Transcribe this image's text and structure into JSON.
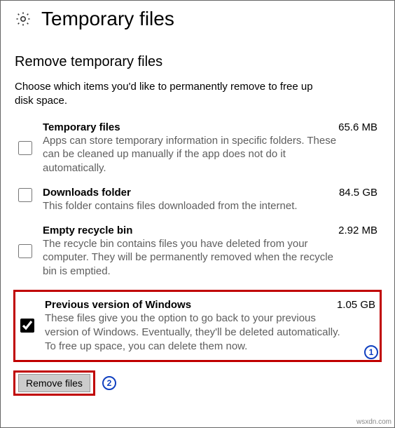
{
  "header": {
    "title": "Temporary files"
  },
  "section": {
    "heading": "Remove temporary files",
    "description": "Choose which items you'd like to permanently remove to free up disk space."
  },
  "items": [
    {
      "title": "Temporary files",
      "size": "65.6 MB",
      "description": "Apps can store temporary information in specific folders. These can be cleaned up manually if the app does not do it automatically.",
      "checked": false
    },
    {
      "title": "Downloads folder",
      "size": "84.5 GB",
      "description": "This folder contains files downloaded from the internet.",
      "checked": false
    },
    {
      "title": "Empty recycle bin",
      "size": "2.92 MB",
      "description": "The recycle bin contains files you have deleted from your computer. They will be permanently removed when the recycle bin is emptied.",
      "checked": false
    },
    {
      "title": "Previous version of Windows",
      "size": "1.05 GB",
      "description": "These files give you the option to go back to your previous version of Windows. Eventually, they'll be deleted automatically. To free up space, you can delete them now.",
      "checked": true
    }
  ],
  "actions": {
    "remove_label": "Remove files"
  },
  "callouts": {
    "one": "1",
    "two": "2"
  },
  "watermark": "wsxdn.com"
}
